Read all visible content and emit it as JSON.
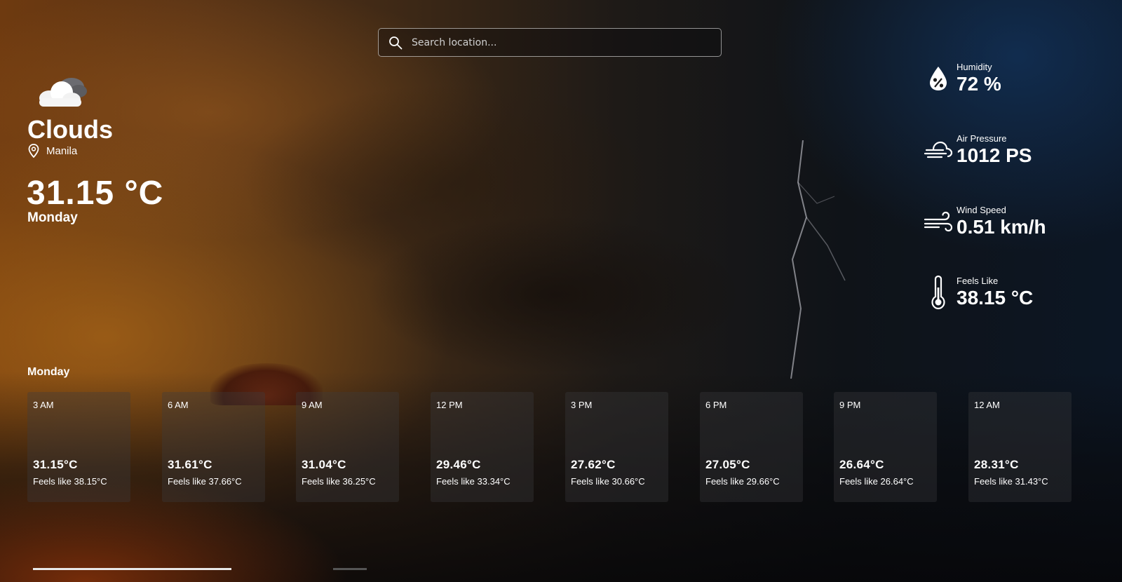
{
  "search": {
    "placeholder": "Search location..."
  },
  "current": {
    "icon": "clouds-icon",
    "condition": "Clouds",
    "location": "Manila",
    "temperature": "31.15 °C",
    "day": "Monday"
  },
  "stats": [
    {
      "icon": "humidity-icon",
      "label": "Humidity",
      "value": "72 %"
    },
    {
      "icon": "air-pressure-icon",
      "label": "Air Pressure",
      "value": "1012 PS"
    },
    {
      "icon": "wind-icon",
      "label": "Wind Speed",
      "value": "0.51 km/h"
    },
    {
      "icon": "thermometer-icon",
      "label": "Feels Like",
      "value": "38.15 °C"
    }
  ],
  "forecast": {
    "title": "Monday",
    "items": [
      {
        "time": "3 AM",
        "temp": "31.15°C",
        "feels": "Feels like 38.15°C"
      },
      {
        "time": "6 AM",
        "temp": "31.61°C",
        "feels": "Feels like 37.66°C"
      },
      {
        "time": "9 AM",
        "temp": "31.04°C",
        "feels": "Feels like 36.25°C"
      },
      {
        "time": "12 PM",
        "temp": "29.46°C",
        "feels": "Feels like 33.34°C"
      },
      {
        "time": "3 PM",
        "temp": "27.62°C",
        "feels": "Feels like 30.66°C"
      },
      {
        "time": "6 PM",
        "temp": "27.05°C",
        "feels": "Feels like 29.66°C"
      },
      {
        "time": "9 PM",
        "temp": "26.64°C",
        "feels": "Feels like 26.64°C"
      },
      {
        "time": "12 AM",
        "temp": "28.31°C",
        "feels": "Feels like 31.43°C"
      }
    ]
  }
}
